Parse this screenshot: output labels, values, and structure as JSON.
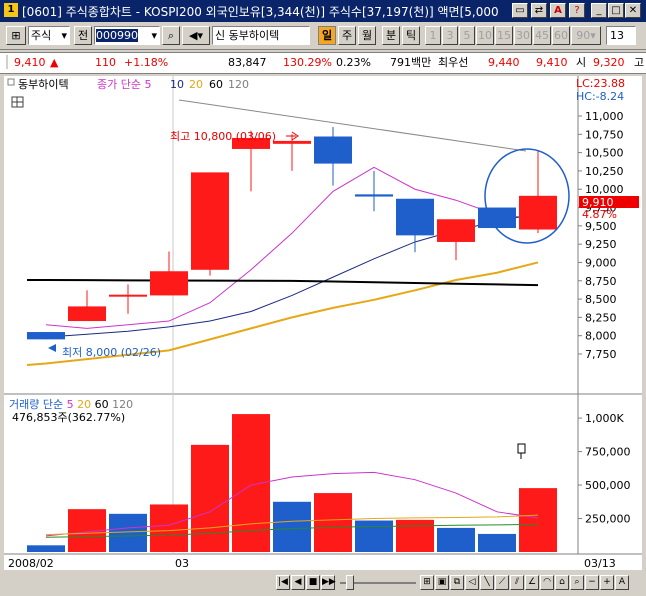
{
  "window": {
    "title": "[0601] 주식종합차트 - KOSPI200 외국인보유[3,344(천)] 주식수[37,197(천)] 액면[5,000",
    "app_icon": "1"
  },
  "toolbar": {
    "market": "주식",
    "jeon": "전",
    "code": "000990",
    "name": "동부하이텍",
    "periods": [
      "일",
      "주",
      "월",
      "분",
      "틱"
    ],
    "minutes": [
      "1",
      "3",
      "5",
      "10",
      "15",
      "30",
      "45",
      "60",
      "90"
    ],
    "count": "13"
  },
  "info": {
    "price": "9,410",
    "change_arrow": "▲",
    "change": "110",
    "change_pct": "+1.18%",
    "volume": "83,847",
    "vol_ratio": "130.29%",
    "turnover": "0.23%",
    "amount": "791백만",
    "best_label": "최우선",
    "best_ask": "9,440",
    "best_bid": "9,410",
    "open_label": "시",
    "open": "9,320",
    "high_label": "고"
  },
  "price_panel": {
    "legend_name": "동부하이텍",
    "legend_ma": "종가 단순 5",
    "legend_ma_periods": [
      "10",
      "20",
      "60",
      "120"
    ],
    "lc": "LC:23.88",
    "hc": "HC:-8.24",
    "high_annotation": "최고 10,800 (03/06)",
    "low_annotation": "최저 8,000 (02/26)",
    "current_price_tag": "9,910",
    "current_pct_tag": "4.87%",
    "y_ticks": [
      "11,000",
      "10,750",
      "10,500",
      "10,250",
      "10,000",
      "9,750",
      "9,500",
      "9,250",
      "9,000",
      "8,750",
      "8,500",
      "8,250",
      "8,000",
      "7,750"
    ]
  },
  "volume_panel": {
    "legend": "거래량 단순",
    "legend_periods": [
      "5",
      "20",
      "60",
      "120"
    ],
    "last_volume": "476,853주(362.77%)",
    "y_ticks": [
      "1,000K",
      "750,000",
      "500,000",
      "250,000"
    ]
  },
  "x_axis": {
    "labels": [
      "2008/02",
      "03"
    ],
    "right_label": "03/13"
  },
  "colors": {
    "up": "#ff1a1a",
    "down": "#1e5fcc",
    "ma5": "#cc33cc",
    "ma10": "#1a2a80",
    "ma20": "#e6a817",
    "ma60": "#000000"
  },
  "chart_data": [
    {
      "type": "candlestick",
      "title": "동부하이텍",
      "ylim": [
        7550,
        11250
      ],
      "candles": [
        {
          "open": 8050,
          "high": 8050,
          "low": 7950,
          "close": 7950
        },
        {
          "open": 8200,
          "high": 8620,
          "low": 8200,
          "close": 8400
        },
        {
          "open": 8560,
          "high": 8700,
          "low": 8300,
          "close": 8560
        },
        {
          "open": 8550,
          "high": 9150,
          "low": 8550,
          "close": 8880
        },
        {
          "open": 8900,
          "high": 10230,
          "low": 8820,
          "close": 10230
        },
        {
          "open": 10550,
          "high": 10800,
          "low": 9970,
          "close": 10700
        },
        {
          "open": 10620,
          "high": 10750,
          "low": 10250,
          "close": 10660
        },
        {
          "open": 10720,
          "high": 10850,
          "low": 10050,
          "close": 10350
        },
        {
          "open": 9930,
          "high": 10250,
          "low": 9700,
          "close": 9900
        },
        {
          "open": 9870,
          "high": 9870,
          "low": 9140,
          "close": 9370
        },
        {
          "open": 9280,
          "high": 9570,
          "low": 9030,
          "close": 9590
        },
        {
          "open": 9750,
          "high": 9750,
          "low": 9450,
          "close": 9470
        },
        {
          "open": 9450,
          "high": 10520,
          "low": 9400,
          "close": 9910
        }
      ],
      "series": [
        {
          "name": "5",
          "values": [
            8150,
            8100,
            8150,
            8200,
            8450,
            8900,
            9400,
            9970,
            10300,
            10000,
            9850,
            9650,
            9600
          ]
        },
        {
          "name": "10",
          "values": [
            7980,
            8020,
            8060,
            8120,
            8200,
            8330,
            8550,
            8800,
            9050,
            9280,
            9440,
            9560,
            9670
          ]
        },
        {
          "name": "20",
          "values": [
            7620,
            7680,
            7740,
            7800,
            7950,
            8100,
            8250,
            8380,
            8490,
            8620,
            8760,
            8860,
            9000
          ]
        },
        {
          "name": "60",
          "values": [
            8760,
            8758,
            8756,
            8754,
            8752,
            8750,
            8748,
            8740,
            8730,
            8720,
            8710,
            8700,
            8690
          ]
        }
      ]
    },
    {
      "type": "bar",
      "title": "거래량",
      "ylim": [
        0,
        1150000
      ],
      "values": [
        50000,
        320000,
        285000,
        355000,
        800000,
        1030000,
        375000,
        440000,
        235000,
        240000,
        180000,
        135000,
        477000
      ],
      "up": [
        false,
        true,
        false,
        true,
        true,
        true,
        false,
        true,
        false,
        true,
        false,
        false,
        true
      ],
      "series": [
        {
          "name": "5",
          "values": [
            120000,
            150000,
            180000,
            200000,
            300000,
            500000,
            560000,
            585000,
            595000,
            540000,
            440000,
            300000,
            255000
          ]
        },
        {
          "name": "20",
          "values": [
            130000,
            140000,
            150000,
            160000,
            180000,
            210000,
            230000,
            240000,
            250000,
            255000,
            258000,
            262000,
            275000
          ]
        },
        {
          "name": "60",
          "values": [
            110000,
            115000,
            120000,
            125000,
            140000,
            160000,
            175000,
            185000,
            190000,
            195000,
            200000,
            203000,
            206000
          ]
        }
      ]
    }
  ]
}
